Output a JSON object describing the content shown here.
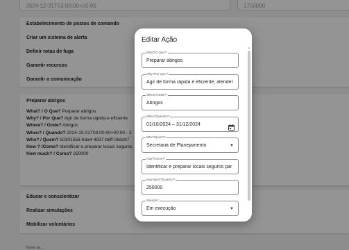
{
  "background": {
    "top_fields": [
      "2024-12-31T03:00:00+00:00",
      "1700000"
    ],
    "cards": [
      {
        "title": "Estabelecimento de postos de comando"
      },
      {
        "title": "Criar um sistema de alerta"
      },
      {
        "title": "Definir rotas de fuga"
      },
      {
        "title": "Garantir recursos"
      },
      {
        "title": "Garantir a comunicação"
      }
    ],
    "expanded_card": {
      "title": "Preparar abrigos",
      "rows": [
        {
          "label": "What? / O Que?",
          "value": "Preparar abrigos"
        },
        {
          "label": "Why? / Por Que?",
          "value": "Agir de forma rápida e eficiente"
        },
        {
          "label": "Where? / Onde?",
          "value": "Abrigos"
        },
        {
          "label": "When? / Quando?",
          "value": "2024-10-01T03:00:00+00:00 - 2"
        },
        {
          "label": "Who? / Quem?",
          "value": "50301556-6da4-4937-b8ff-08dc87"
        },
        {
          "label": "How ? /Como?",
          "value": "Identificar e preparar locais seguros"
        },
        {
          "label": "How much? / Como?",
          "value": "250000"
        }
      ]
    },
    "cards_after": [
      {
        "title": "Educar e conscientizar"
      },
      {
        "title": "Realizar simulações"
      },
      {
        "title": "Mobilizar voluntários"
      }
    ],
    "bottom_text": "Nome da..."
  },
  "dialog": {
    "title": "Editar Ação",
    "fields": [
      {
        "label": "What?/O Que?*",
        "value": "Preparar abrigos",
        "type": "text"
      },
      {
        "label": "Why?/Por Que?*",
        "value": "Agir de forma rápida e eficiente, atender",
        "type": "text"
      },
      {
        "label": "Where?/Onde?*",
        "value": "Abrigos",
        "type": "text"
      },
      {
        "label": "When?/Quando?*",
        "value": "01/10/2024 – 31/12/2024",
        "type": "date-range",
        "icon": "calendar-icon"
      },
      {
        "label": "Who?/Quem?*",
        "value": "Secretaria de Planejamento",
        "type": "select",
        "icon": "chevron-down-icon"
      },
      {
        "label": "How?/Como?*",
        "value": "Identificar e preparar locais seguros par",
        "type": "text"
      },
      {
        "label": "How Much?/Quanto?*",
        "value": "250000",
        "type": "text"
      },
      {
        "label": "Situação*",
        "value": "Em execução",
        "type": "select",
        "icon": "chevron-down-icon"
      }
    ]
  }
}
